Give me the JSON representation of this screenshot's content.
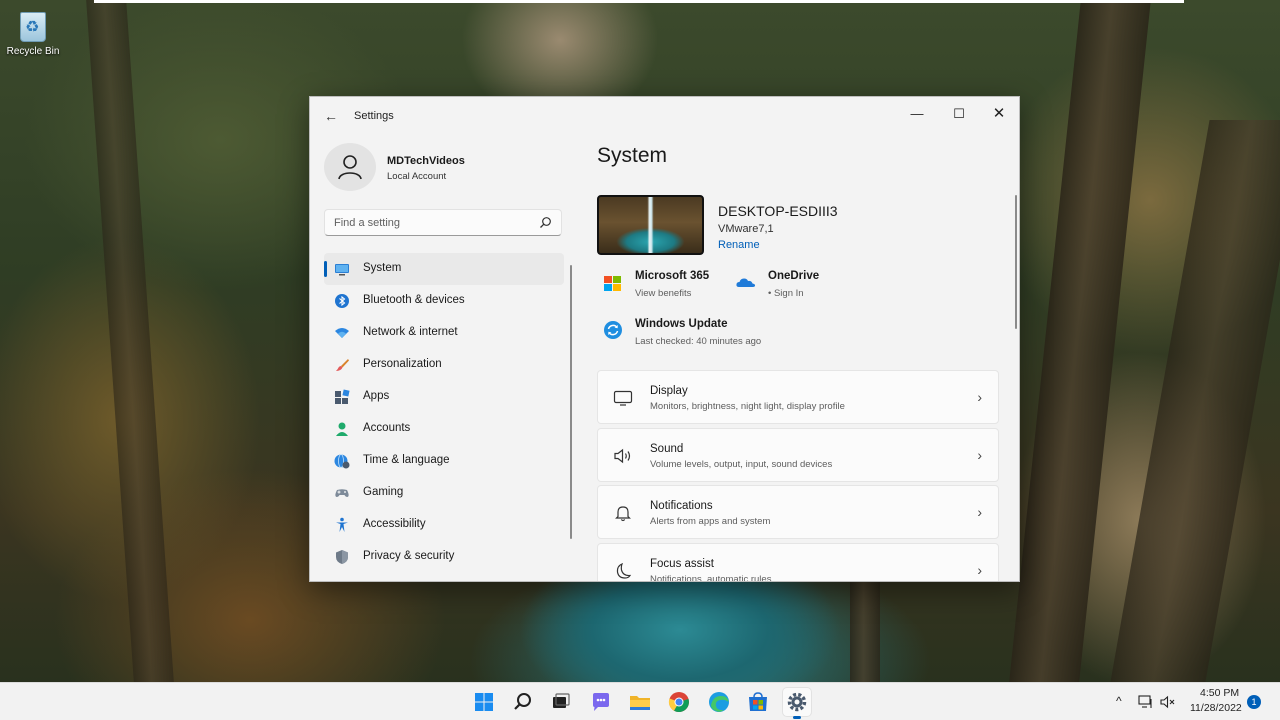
{
  "desktop": {
    "recycle_bin_label": "Recycle Bin"
  },
  "window": {
    "title": "Settings",
    "minimize_glyph": "—",
    "maximize_glyph": "☐",
    "close_glyph": "✕",
    "back_glyph": "←"
  },
  "profile": {
    "name": "MDTechVideos",
    "account_type": "Local Account"
  },
  "search": {
    "placeholder": "Find a setting"
  },
  "nav": {
    "items": [
      {
        "label": "System",
        "icon": "display-icon",
        "active": true
      },
      {
        "label": "Bluetooth & devices",
        "icon": "bluetooth-icon"
      },
      {
        "label": "Network & internet",
        "icon": "wifi-icon"
      },
      {
        "label": "Personalization",
        "icon": "brush-icon"
      },
      {
        "label": "Apps",
        "icon": "apps-icon"
      },
      {
        "label": "Accounts",
        "icon": "person-icon"
      },
      {
        "label": "Time & language",
        "icon": "globe-clock-icon"
      },
      {
        "label": "Gaming",
        "icon": "gamepad-icon"
      },
      {
        "label": "Accessibility",
        "icon": "accessibility-icon"
      },
      {
        "label": "Privacy & security",
        "icon": "shield-icon"
      }
    ]
  },
  "main": {
    "title": "System",
    "device": {
      "name": "DESKTOP-ESDIII3",
      "model": "VMware7,1",
      "rename_label": "Rename"
    },
    "quick": [
      {
        "title": "Microsoft 365",
        "subtitle": "View benefits",
        "icon": "microsoft-logo-icon"
      },
      {
        "title": "OneDrive",
        "subtitle": "• Sign In",
        "icon": "onedrive-icon"
      },
      {
        "title": "Windows Update",
        "subtitle": "Last checked: 40 minutes ago",
        "icon": "windows-update-icon"
      }
    ],
    "cards": [
      {
        "title": "Display",
        "subtitle": "Monitors, brightness, night light, display profile",
        "icon": "monitor-icon"
      },
      {
        "title": "Sound",
        "subtitle": "Volume levels, output, input, sound devices",
        "icon": "speaker-icon"
      },
      {
        "title": "Notifications",
        "subtitle": "Alerts from apps and system",
        "icon": "bell-icon"
      },
      {
        "title": "Focus assist",
        "subtitle": "Notifications, automatic rules",
        "icon": "moon-icon"
      }
    ],
    "chevron_glyph": "›"
  },
  "taskbar": {
    "time": "4:50 PM",
    "date": "11/28/2022",
    "notification_count": "1",
    "accent": "#005fb8"
  }
}
